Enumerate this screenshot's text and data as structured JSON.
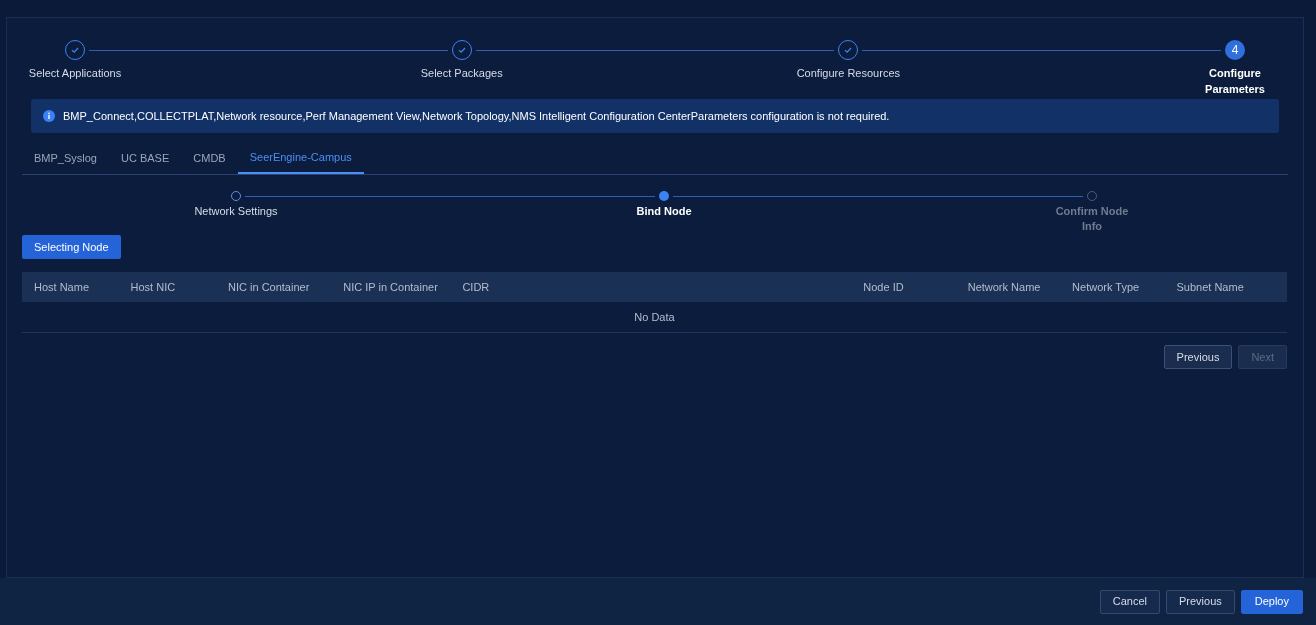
{
  "steps": [
    {
      "label": "Select Applications",
      "kind": "done"
    },
    {
      "label": "Select Packages",
      "kind": "done"
    },
    {
      "label": "Configure Resources",
      "kind": "done"
    },
    {
      "label": "Configure Parameters",
      "kind": "current",
      "number": "4"
    }
  ],
  "notice": {
    "text": "BMP_Connect,COLLECTPLAT,Network resource,Perf Management View,Network Topology,NMS Intelligent Configuration CenterParameters configuration is not required."
  },
  "tabs": [
    {
      "label": "BMP_Syslog",
      "selected": false
    },
    {
      "label": "UC BASE",
      "selected": false
    },
    {
      "label": "CMDB",
      "selected": false
    },
    {
      "label": "SeerEngine-Campus",
      "selected": true
    }
  ],
  "sub_steps": [
    {
      "label": "Network Settings",
      "kind": "done"
    },
    {
      "label": "Bind Node",
      "kind": "current"
    },
    {
      "label": "Confirm Node Info",
      "kind": "pending"
    }
  ],
  "select_button": "Selecting Node",
  "table": {
    "columns": [
      "Host Name",
      "Host NIC",
      "NIC in Container",
      "NIC IP in Container",
      "CIDR",
      "Node ID",
      "Network Name",
      "Network Type",
      "Subnet Name"
    ],
    "empty_text": "No Data"
  },
  "pager": [
    {
      "label": "Previous",
      "disabled": false
    },
    {
      "label": "Next",
      "disabled": true
    }
  ],
  "footer_buttons": [
    {
      "label": "Cancel",
      "primary": false
    },
    {
      "label": "Previous",
      "primary": false
    },
    {
      "label": "Deploy",
      "primary": true
    }
  ]
}
